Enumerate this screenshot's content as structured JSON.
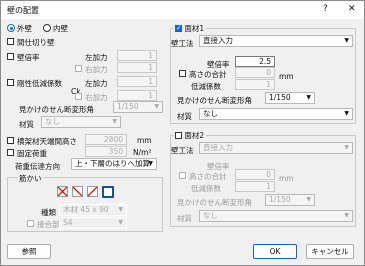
{
  "title": "壁の配置",
  "title_help": "?",
  "title_close": "✕",
  "left": {
    "radio_outer": "外壁",
    "radio_inner": "内壁",
    "partition": "間仕切り壁",
    "wall_ratio": "壁倍率",
    "left_force": "左加力",
    "left_force_val": "1",
    "right_force": "右加力",
    "right_force_val": "1",
    "rigidity_reduction": "剛性低減係数",
    "ck": "Ck",
    "left_force2": "左加力",
    "left_force2_val": "1",
    "right_force2": "右加力",
    "right_force2_val": "1",
    "apparent_section": "見かけのせん断変形角",
    "apparent_section_val": "1/150",
    "material": "材質",
    "material_val": "なし",
    "beam_height": "横架材天端間高さ",
    "beam_height_val": "2800",
    "beam_height_unit": "mm",
    "fixed_load": "固定荷重",
    "fixed_load_val": "350",
    "fixed_load_unit": "N/m²",
    "load_dir": "荷重伝達方向",
    "load_dir_val": "上・下層のはりへ加算",
    "brace_group": "筋かい",
    "kind_label": "種類",
    "kind_val": "木材 45 x 90",
    "joint_label": "接合部",
    "joint_val": "S4"
  },
  "panel1": {
    "title": "面材1",
    "method_label": "壁工法",
    "method_val": "直接入力",
    "wall_ratio": "壁倍率",
    "wall_ratio_val": "2.5",
    "height_total": "高さの合計",
    "height_total_val": "0",
    "unit": "mm",
    "reduction": "低減係数",
    "reduction_val": "1",
    "apparent_section": "見かけのせん断変形角",
    "apparent_section_val": "1/150",
    "material": "材質",
    "material_val": "なし"
  },
  "panel2": {
    "title": "面材2",
    "method_label": "壁工法",
    "method_val": "直接入力",
    "wall_ratio": "壁倍率",
    "height_total": "高さの合計",
    "height_total_val": "0",
    "unit": "mm",
    "reduction": "低減係数",
    "reduction_val": "1",
    "apparent_section": "見かけのせん断変形角",
    "apparent_section_val": "1/150",
    "material": "材質",
    "material_val": "なし"
  },
  "buttons": {
    "ref": "参照",
    "ok": "OK",
    "cancel": "キャンセル"
  },
  "colors": {
    "accent": "#0a64d8",
    "window_bg": "#f0f0f0"
  }
}
